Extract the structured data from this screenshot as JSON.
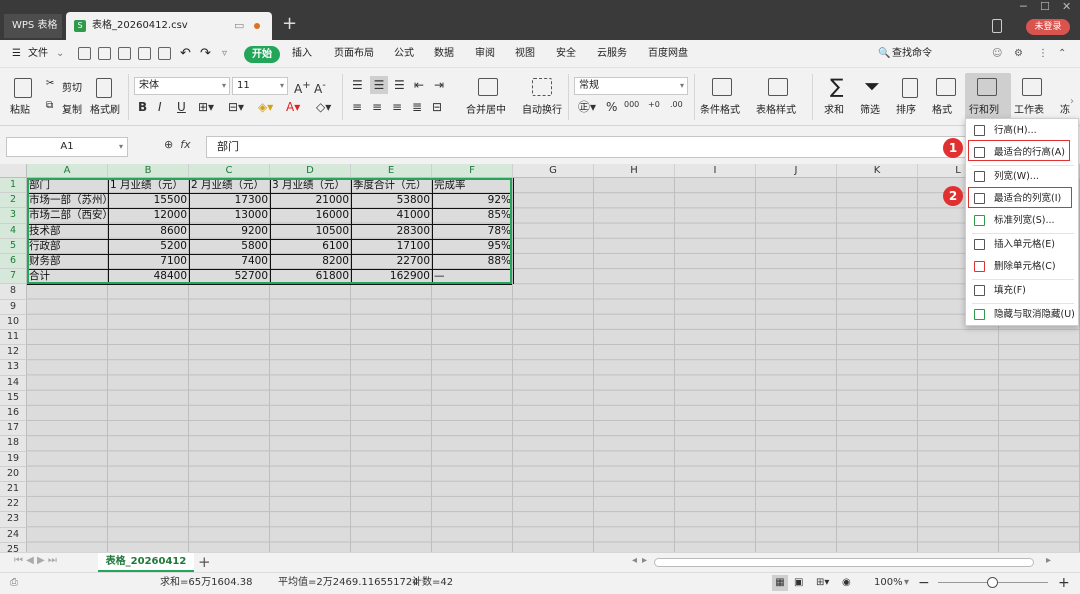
{
  "titlebar": {
    "wps_tab": "WPS 表格",
    "file_tab": "表格_20260412.csv",
    "login": "未登录"
  },
  "menu": {
    "file": "文件",
    "start": "开始",
    "items": [
      "插入",
      "页面布局",
      "公式",
      "数据",
      "审阅",
      "视图",
      "安全",
      "云服务",
      "百度网盘"
    ],
    "search": "查找命令"
  },
  "ribbon": {
    "paste": "粘贴",
    "cut": "剪切",
    "copy": "复制",
    "format_painter": "格式刷",
    "font_name": "宋体",
    "font_size": "11",
    "merge_center": "合并居中",
    "wrap_text": "自动换行",
    "number_format": "常规",
    "cond_format": "条件格式",
    "table_style": "表格样式",
    "sum": "求和",
    "filter": "筛选",
    "sort": "排序",
    "format": "格式",
    "row_col": "行和列",
    "worksheet": "工作表",
    "more": "冻"
  },
  "formula_bar": {
    "cell_ref": "A1",
    "fx": "fx",
    "content": "部门"
  },
  "columns": [
    "A",
    "B",
    "C",
    "D",
    "E",
    "F",
    "G",
    "H",
    "I",
    "J",
    "K",
    "L"
  ],
  "rows": [
    "1",
    "2",
    "3",
    "4",
    "5",
    "6",
    "7",
    "8",
    "9",
    "10",
    "11",
    "12",
    "13",
    "14",
    "15",
    "16",
    "17",
    "18",
    "19",
    "20",
    "21",
    "22",
    "23",
    "24",
    "25"
  ],
  "table": {
    "header": [
      "部门",
      "1 月业绩（元）",
      "2 月业绩（元）",
      "3 月业绩（元）",
      "季度合计（元）",
      "完成率"
    ],
    "data": [
      [
        "市场一部（苏州）",
        "15500",
        "17300",
        "21000",
        "53800",
        "92%"
      ],
      [
        "市场二部（西安）",
        "12000",
        "13000",
        "16000",
        "41000",
        "85%"
      ],
      [
        "技术部",
        "8600",
        "9200",
        "10500",
        "28300",
        "78%"
      ],
      [
        "行政部",
        "5200",
        "5800",
        "6100",
        "17100",
        "95%"
      ],
      [
        "财务部",
        "7100",
        "7400",
        "8200",
        "22700",
        "88%"
      ],
      [
        "合计",
        "48400",
        "52700",
        "61800",
        "162900",
        "—"
      ]
    ]
  },
  "context_menu": {
    "items": [
      "行高(H)...",
      "最适合的行高(A)",
      "列宽(W)...",
      "最适合的列宽(I)",
      "标准列宽(S)...",
      "插入单元格(E)",
      "删除单元格(C)",
      "填充(F)",
      "隐藏与取消隐藏(U)"
    ],
    "badges": [
      "1",
      "2"
    ]
  },
  "sheet_tabs": [
    "表格_20260412"
  ],
  "status": {
    "sum": "求和=65万1604.38",
    "avg": "平均值=2万2469.116551724",
    "count": "计数=42",
    "zoom": "100%"
  },
  "colors": {
    "accent": "#23a55a",
    "highlight_red": "#e03030",
    "titlebar": "#3a3a3a"
  }
}
